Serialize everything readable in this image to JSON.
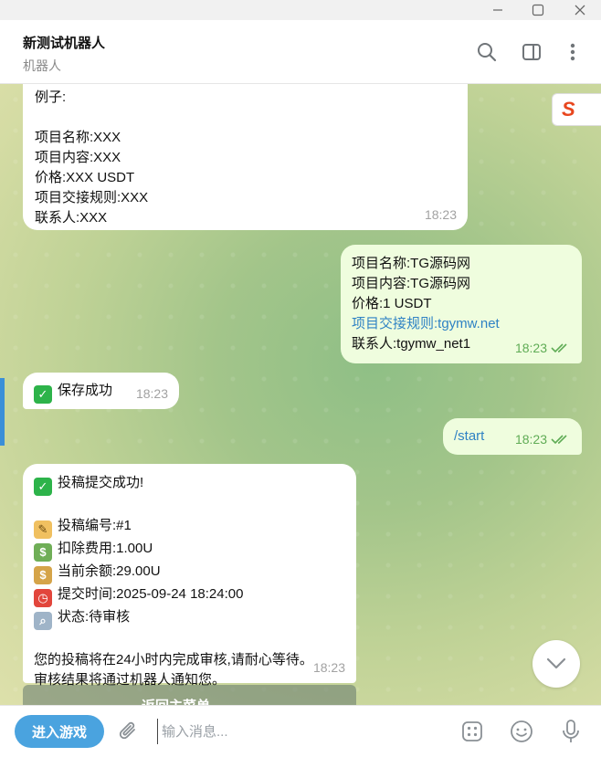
{
  "header": {
    "title": "新测试机器人",
    "subtitle": "机器人"
  },
  "messages": {
    "m1": {
      "lines": [
        "例子:",
        "",
        "项目名称:XXX",
        "项目内容:XXX",
        "价格:XXX USDT",
        "项目交接规则:XXX",
        "联系人:XXX"
      ],
      "time": "18:23"
    },
    "m2": {
      "line1": "项目名称:TG源码网",
      "line2": "项目内容:TG源码网",
      "line3": "价格:1 USDT",
      "line4": "项目交接规则:tgymw.net",
      "line5": "联系人:tgymw_net1",
      "time": "18:23"
    },
    "m3": {
      "text": "保存成功",
      "time": "18:23"
    },
    "m4": {
      "text": "/start",
      "time": "18:23"
    },
    "m5": {
      "title": "投稿提交成功!",
      "id": "投稿编号:#1",
      "fee": "扣除费用:1.00U",
      "balance": "当前余额:29.00U",
      "submit_time": "提交时间:2025-09-24 18:24:00",
      "status": "状态:待审核",
      "note1": "您的投稿将在24小时内完成审核,请耐心等待。",
      "note2": "审核结果将通过机器人通知您。",
      "time": "18:23"
    }
  },
  "keyboard": {
    "button_label": "返回主菜单"
  },
  "input": {
    "game_button": "进入游戏",
    "placeholder": "输入消息..."
  }
}
